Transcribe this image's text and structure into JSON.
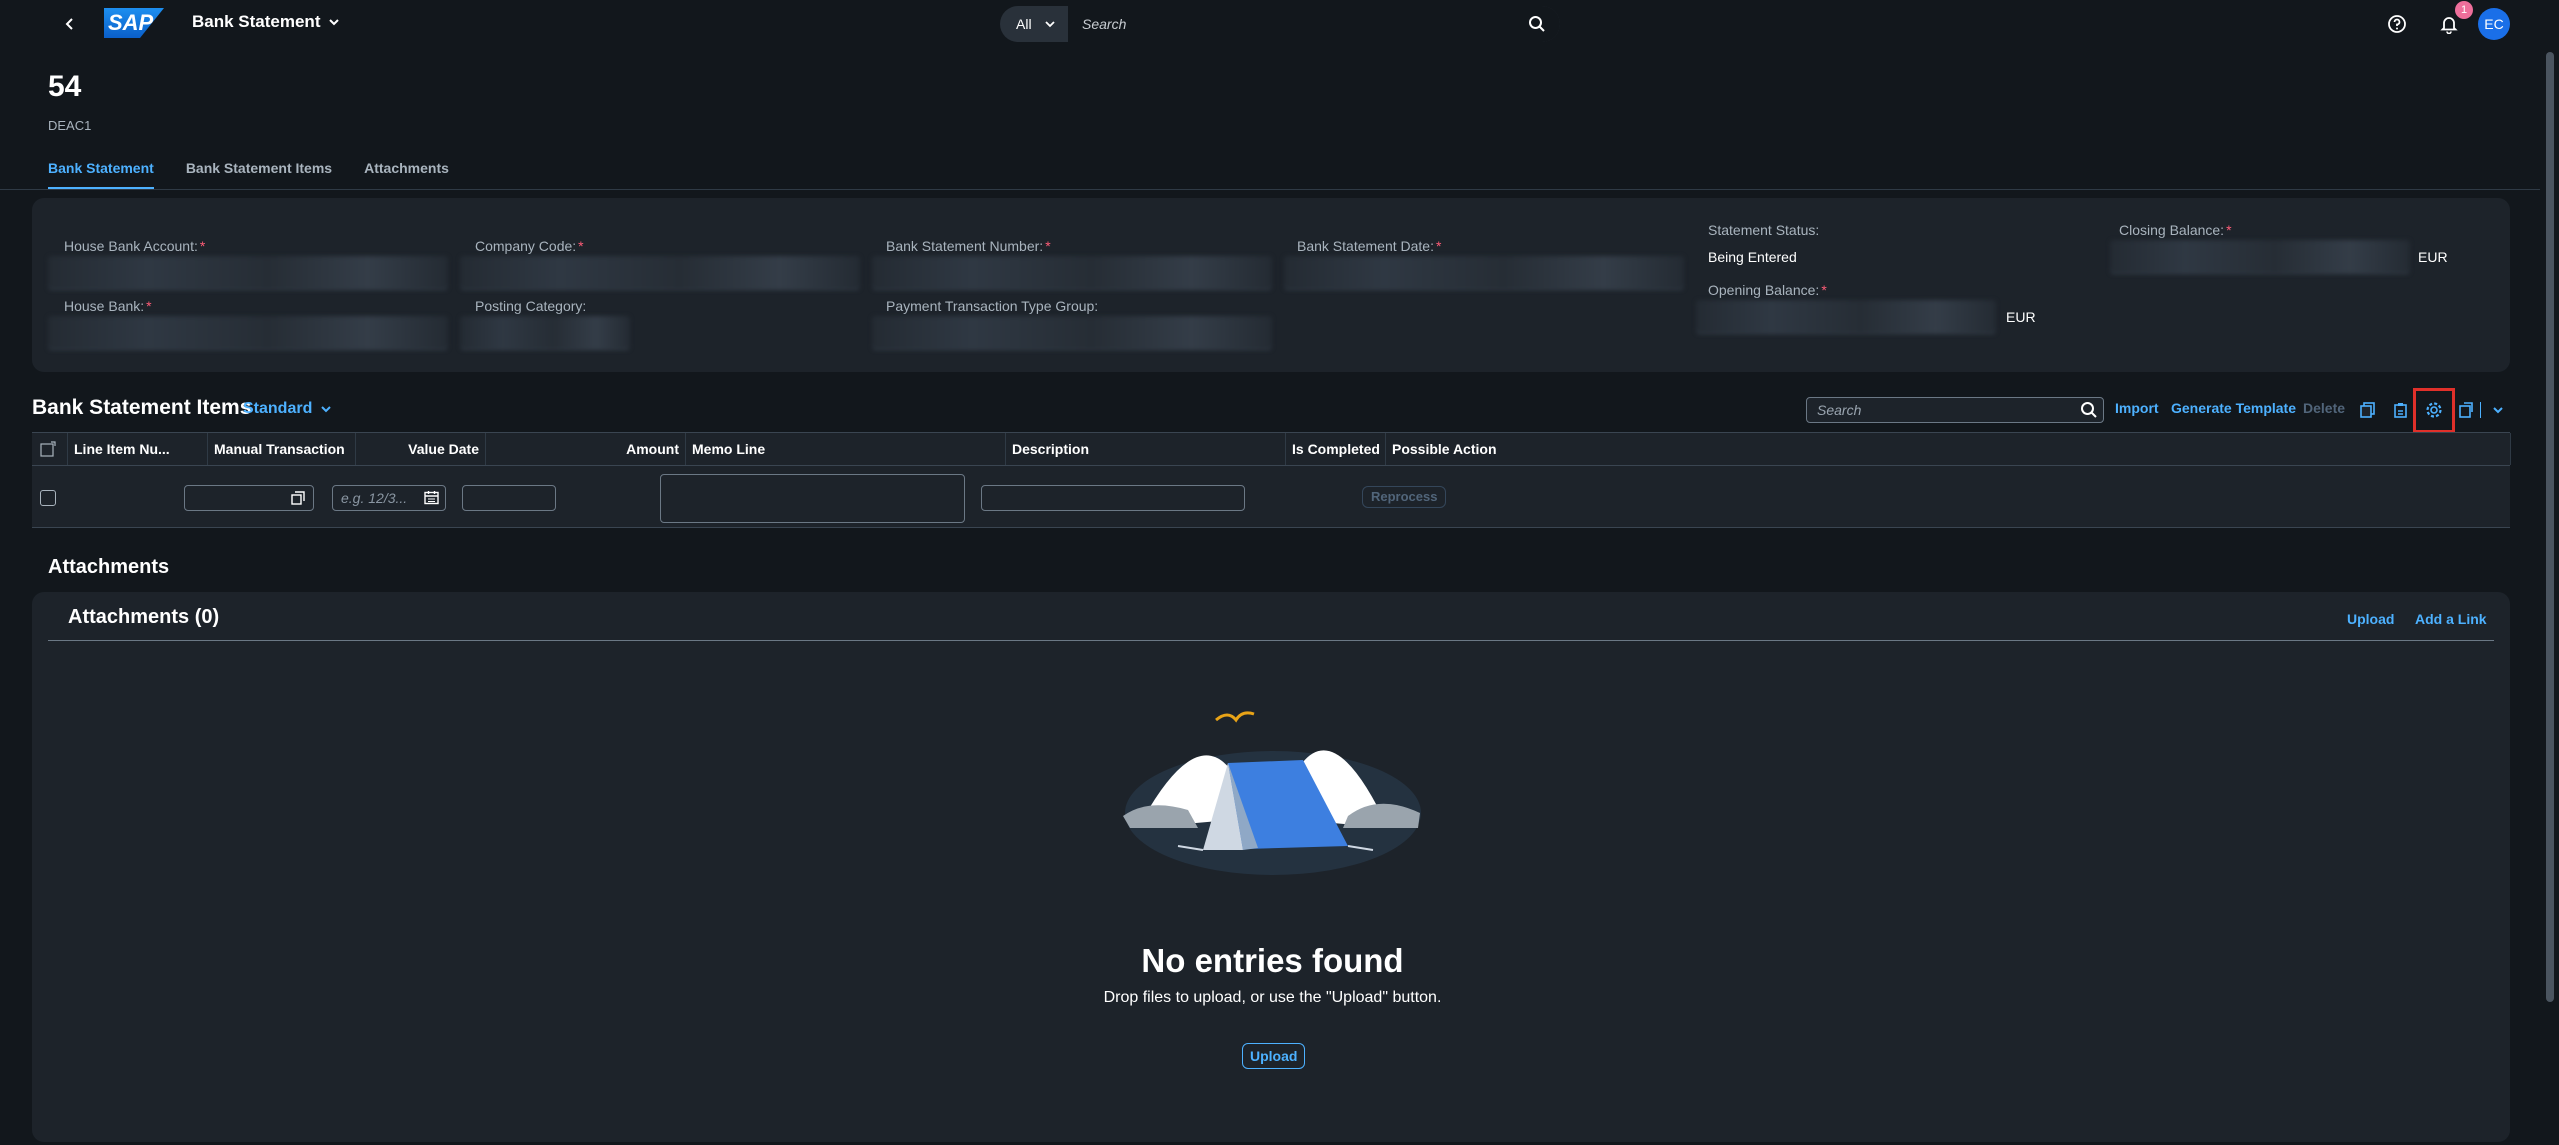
{
  "shell": {
    "app_title": "Bank Statement",
    "logo_text": "SAP",
    "search_scope": "All",
    "search_placeholder": "Search",
    "notification_count": "1",
    "avatar_initials": "EC"
  },
  "header": {
    "title": "54",
    "subtitle": "DEAC1",
    "tabs": [
      "Bank Statement",
      "Bank Statement Items",
      "Attachments"
    ]
  },
  "form": {
    "house_bank_account": "House Bank Account:",
    "company_code": "Company Code:",
    "bank_statement_number": "Bank Statement Number:",
    "bank_statement_date": "Bank Statement Date:",
    "statement_status_label": "Statement Status:",
    "statement_status_value": "Being Entered",
    "closing_balance": "Closing Balance:",
    "closing_currency": "EUR",
    "house_bank": "House Bank:",
    "posting_category": "Posting Category:",
    "payment_transaction_type_group": "Payment Transaction Type Group:",
    "opening_balance": "Opening Balance:",
    "opening_currency": "EUR",
    "required_mark": "*"
  },
  "items": {
    "title": "Bank Statement Items",
    "variant": "Standard",
    "search_placeholder": "Search",
    "import": "Import",
    "generate_template": "Generate Template",
    "delete": "Delete",
    "columns": [
      "Line Item Nu...",
      "Manual Transaction",
      "Value Date",
      "Amount",
      "Memo Line",
      "Description",
      "Is Completed",
      "Possible Action"
    ],
    "date_placeholder": "e.g. 12/3...",
    "reprocess": "Reprocess"
  },
  "attachments": {
    "section_title": "Attachments",
    "card_title": "Attachments (0)",
    "upload": "Upload",
    "add_link": "Add a Link",
    "empty_title": "No entries found",
    "empty_sub": "Drop files to upload, or use the \"Upload\" button.",
    "empty_upload": "Upload"
  },
  "colors": {
    "accent": "#4db1ff",
    "background": "#12171c",
    "card": "#1d232a",
    "required": "#ff5c77",
    "highlight": "#e0302a"
  }
}
